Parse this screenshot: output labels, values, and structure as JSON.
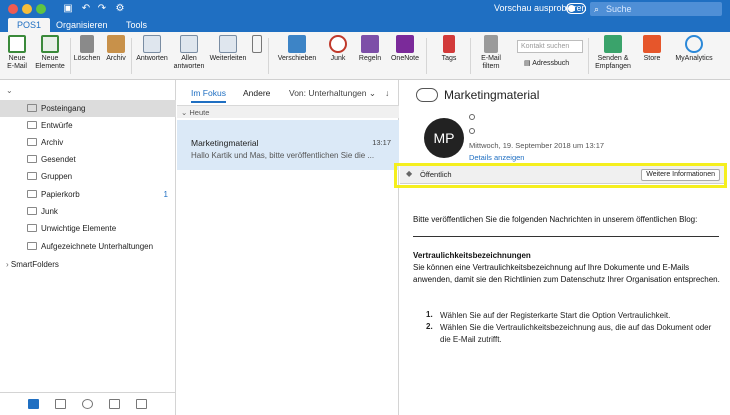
{
  "titlebar": {
    "preview_label": "Vorschau ausprobieren",
    "search_placeholder": "Suche"
  },
  "tabs": [
    {
      "label": "POS1"
    },
    {
      "label": "Organisieren"
    },
    {
      "label": "Tools"
    }
  ],
  "ribbon": {
    "new_email": "Neue\nE-Mail",
    "new_items": "Neue\nElemente",
    "delete": "Löschen",
    "archive": "Archiv",
    "reply": "Antworten",
    "reply_all": "Allen\nantworten",
    "forward": "Weiterleiten",
    "move": "Verschieben",
    "junk": "Junk",
    "rules": "Regeln",
    "onenote": "OneNote",
    "tags": "Tags",
    "filter": "E-Mail\nfiltern",
    "contact_search_placeholder": "Kontakt suchen",
    "address_book": "Adressbuch",
    "send_receive": "Senden &\nEmpfangen",
    "store": "Store",
    "myanalytics": "MyAnalytics"
  },
  "sidebar": {
    "folders": [
      {
        "label": "Posteingang",
        "count": ""
      },
      {
        "label": "Entwürfe",
        "count": ""
      },
      {
        "label": "Archiv",
        "count": ""
      },
      {
        "label": "Gesendet",
        "count": ""
      },
      {
        "label": "Gruppen",
        "count": ""
      },
      {
        "label": "Papierkorb",
        "count": "1"
      },
      {
        "label": "Junk",
        "count": ""
      },
      {
        "label": "Unwichtige Elemente",
        "count": ""
      },
      {
        "label": "Aufgezeichnete Unterhaltungen",
        "count": ""
      }
    ],
    "smartfolders": "SmartFolders"
  },
  "msglist": {
    "tab_focus": "Im Fokus",
    "tab_other": "Andere",
    "sort": "Von: Unterhaltungen",
    "group_header": "Heute",
    "message": {
      "from": "Marketingmaterial",
      "time": "13:17",
      "preview": "Hallo Kartik und Mas, bitte veröffentlichen Sie die ..."
    }
  },
  "reading": {
    "subject": "Marketingmaterial",
    "avatar_initials": "MP",
    "date": "Mittwoch, 19. September 2018 um 13:17",
    "details_link": "Details anzeigen",
    "sensitivity_label": "Öffentlich",
    "more_info_button": "Weitere Informationen",
    "intro": "Bitte veröffentlichen Sie die folgenden Nachrichten in unserem öffentlichen Blog:",
    "heading": "Vertraulichkeitsbezeichnungen",
    "paragraph": "Sie können eine Vertraulichkeitsbezeichnung auf Ihre Dokumente und E-Mails anwenden, damit sie den Richtlinien zum Datenschutz Ihrer Organisation entsprechen.",
    "steps": [
      {
        "num": "1.",
        "text": "Wählen Sie auf der Registerkarte Start die Option Vertraulichkeit."
      },
      {
        "num": "2.",
        "text": "Wählen Sie die Vertraulichkeitsbezeichnung aus, die auf das Dokument oder die E-Mail zutrifft."
      }
    ]
  }
}
